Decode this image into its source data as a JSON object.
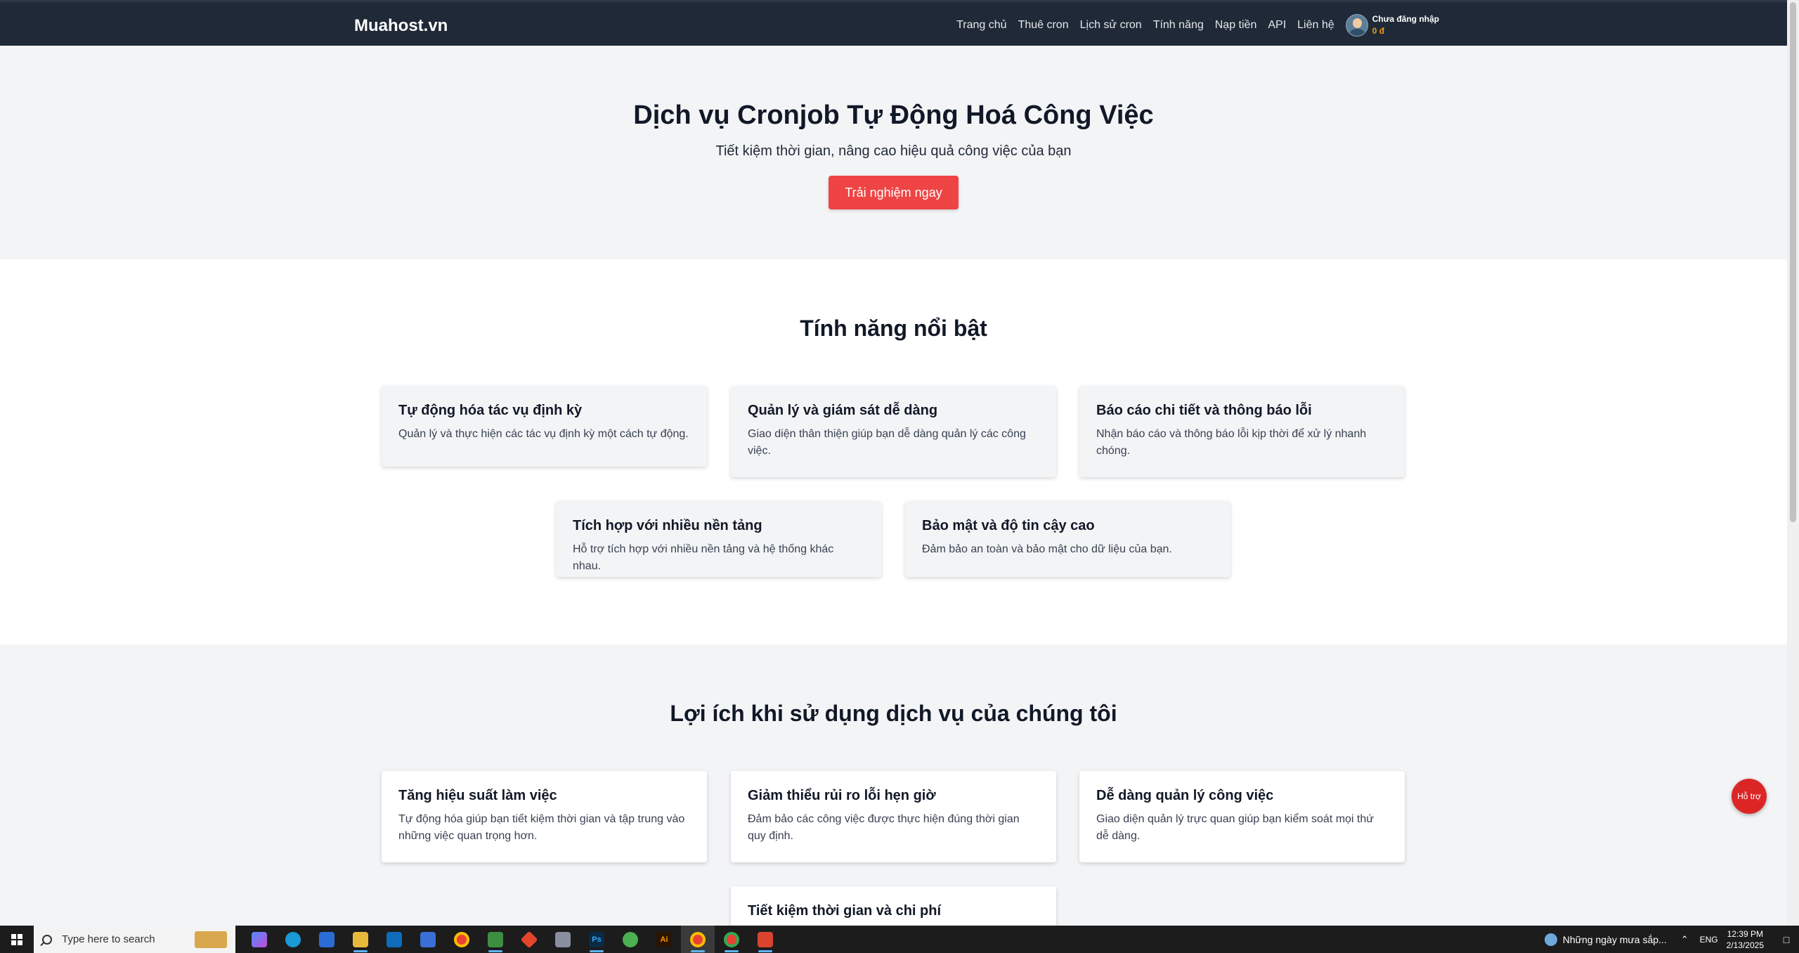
{
  "header": {
    "brand": "Muahost.vn",
    "nav": [
      "Trang chủ",
      "Thuê cron",
      "Lịch sử cron",
      "Tính năng",
      "Nạp tiền",
      "API",
      "Liên hệ"
    ],
    "user_name": "Chưa đăng nhập",
    "user_balance": "0 đ"
  },
  "hero": {
    "title": "Dịch vụ Cronjob Tự Động Hoá Công Việc",
    "subtitle": "Tiết kiệm thời gian, nâng cao hiệu quả công việc của bạn",
    "cta": "Trải nghiệm ngay"
  },
  "features": {
    "title": "Tính năng nổi bật",
    "items": [
      {
        "title": "Tự động hóa tác vụ định kỳ",
        "desc": "Quản lý và thực hiện các tác vụ định kỳ một cách tự động."
      },
      {
        "title": "Quản lý và giám sát dễ dàng",
        "desc": "Giao diện thân thiện giúp bạn dễ dàng quản lý các công việc."
      },
      {
        "title": "Báo cáo chi tiết và thông báo lỗi",
        "desc": "Nhận báo cáo và thông báo lỗi kịp thời để xử lý nhanh chóng."
      },
      {
        "title": "Tích hợp với nhiều nền tảng",
        "desc": "Hỗ trợ tích hợp với nhiều nền tảng và hệ thống khác nhau."
      },
      {
        "title": "Bảo mật và độ tin cậy cao",
        "desc": "Đảm bảo an toàn và bảo mật cho dữ liệu của bạn."
      }
    ]
  },
  "benefits": {
    "title": "Lợi ích khi sử dụng dịch vụ của chúng tôi",
    "items": [
      {
        "title": "Tăng hiệu suất làm việc",
        "desc": "Tự động hóa giúp bạn tiết kiệm thời gian và tập trung vào những việc quan trọng hơn."
      },
      {
        "title": "Giảm thiểu rủi ro lỗi hẹn giờ",
        "desc": "Đảm bảo các công việc được thực hiện đúng thời gian quy định."
      },
      {
        "title": "Dễ dàng quản lý công việc",
        "desc": "Giao diện quản lý trực quan giúp bạn kiểm soát mọi thứ dễ dàng."
      },
      {
        "title": "Tiết kiệm thời gian và chi phí",
        "desc": ""
      }
    ]
  },
  "support_label": "Hỗ trợ",
  "taskbar": {
    "search_placeholder": "Type here to search",
    "weather_text": "Những ngày mưa sắp...",
    "lang": "ENG",
    "time": "12:39 PM",
    "date": "2/13/2025"
  }
}
